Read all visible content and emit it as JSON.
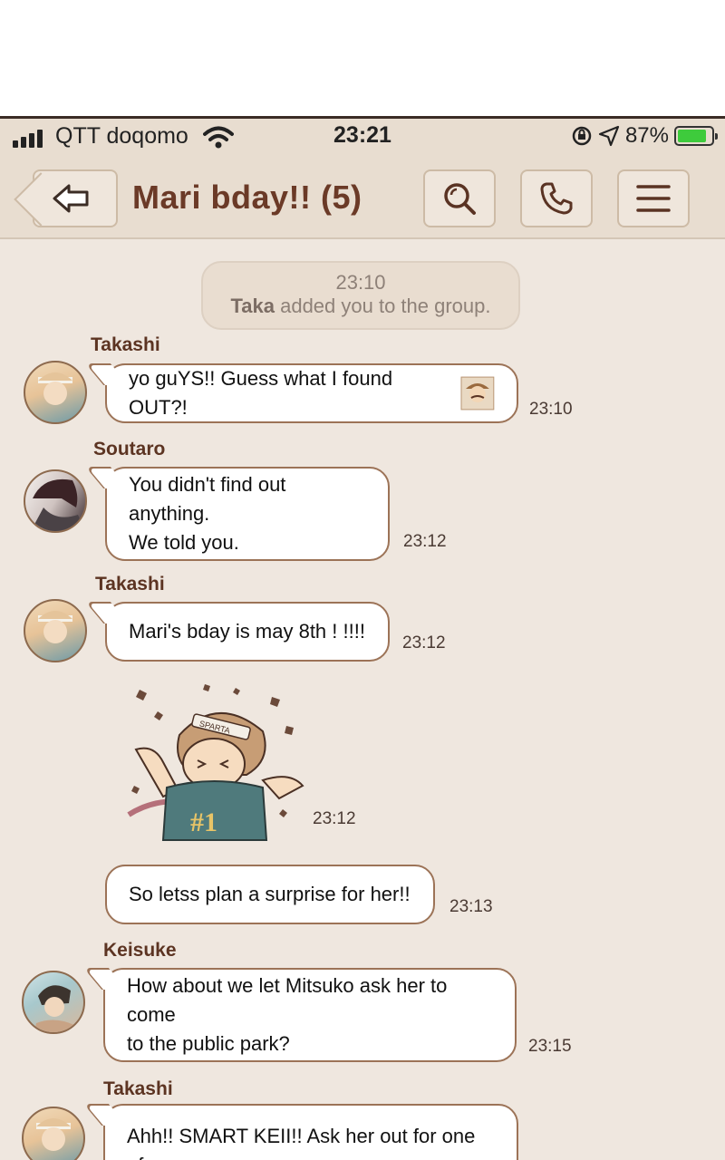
{
  "status": {
    "carrier": "QTT doqomo",
    "time": "23:21",
    "battery": "87%",
    "battery_level": 0.87
  },
  "header": {
    "title": "Mari bday!! (5)"
  },
  "system": {
    "time": "23:10",
    "name": "Taka",
    "text": " added you to the group."
  },
  "messages": [
    {
      "sender": "Takashi",
      "text": "yo guYS!! Guess what I found OUT?!",
      "time": "23:10"
    },
    {
      "sender": "Soutaro",
      "line1": "You didn't find out anything.",
      "line2": "We told you.",
      "time": "23:12"
    },
    {
      "sender": "Takashi",
      "text": "Mari's bday is may 8th ! !!!!",
      "time": "23:12"
    },
    {
      "sticker_text": "#1",
      "sticker_band": "SPARTA",
      "time": "23:12"
    },
    {
      "text": "So letss plan a surprise for her!!",
      "time": "23:13"
    },
    {
      "sender": "Keisuke",
      "line1": "How about we let Mitsuko ask her to come",
      "line2": "to the public park?",
      "time": "23:15"
    },
    {
      "sender": "Takashi",
      "text": "Ahh!! SMART KEII!! Ask her out for one of"
    }
  ]
}
